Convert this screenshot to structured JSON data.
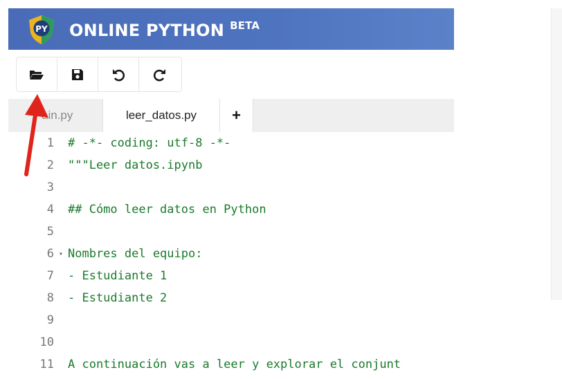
{
  "header": {
    "logo_text": "PY",
    "title": "ONLINE PYTHON",
    "badge": "BETA",
    "background": "#4f74bf"
  },
  "toolbar": {
    "buttons": [
      {
        "name": "open",
        "icon": "folder-open-icon"
      },
      {
        "name": "save",
        "icon": "floppy-disk-icon"
      },
      {
        "name": "undo",
        "icon": "undo-icon"
      },
      {
        "name": "redo",
        "icon": "redo-icon"
      }
    ]
  },
  "tabs": [
    {
      "label": "ain.py",
      "active": false
    },
    {
      "label": "leer_datos.py",
      "active": true
    },
    {
      "label": "+",
      "active": false
    }
  ],
  "editor": {
    "lines": [
      {
        "num": "1",
        "text": "# -*- coding: utf-8 -*-",
        "fold": ""
      },
      {
        "num": "2",
        "text": "\"\"\"Leer datos.ipynb",
        "fold": ""
      },
      {
        "num": "3",
        "text": "",
        "fold": ""
      },
      {
        "num": "4",
        "text": "## Cómo leer datos en Python",
        "fold": ""
      },
      {
        "num": "5",
        "text": "",
        "fold": ""
      },
      {
        "num": "6",
        "text": "Nombres del equipo:",
        "fold": "▾"
      },
      {
        "num": "7",
        "text": "- Estudiante 1",
        "fold": ""
      },
      {
        "num": "8",
        "text": "- Estudiante 2",
        "fold": ""
      },
      {
        "num": "9",
        "text": "",
        "fold": ""
      },
      {
        "num": "10",
        "text": "",
        "fold": ""
      },
      {
        "num": "11",
        "text": "A continuación vas a leer y explorar el conjunt",
        "fold": ""
      }
    ],
    "code_color": "#1a7a2a"
  },
  "annotation": {
    "arrow_color": "#e0241b"
  }
}
